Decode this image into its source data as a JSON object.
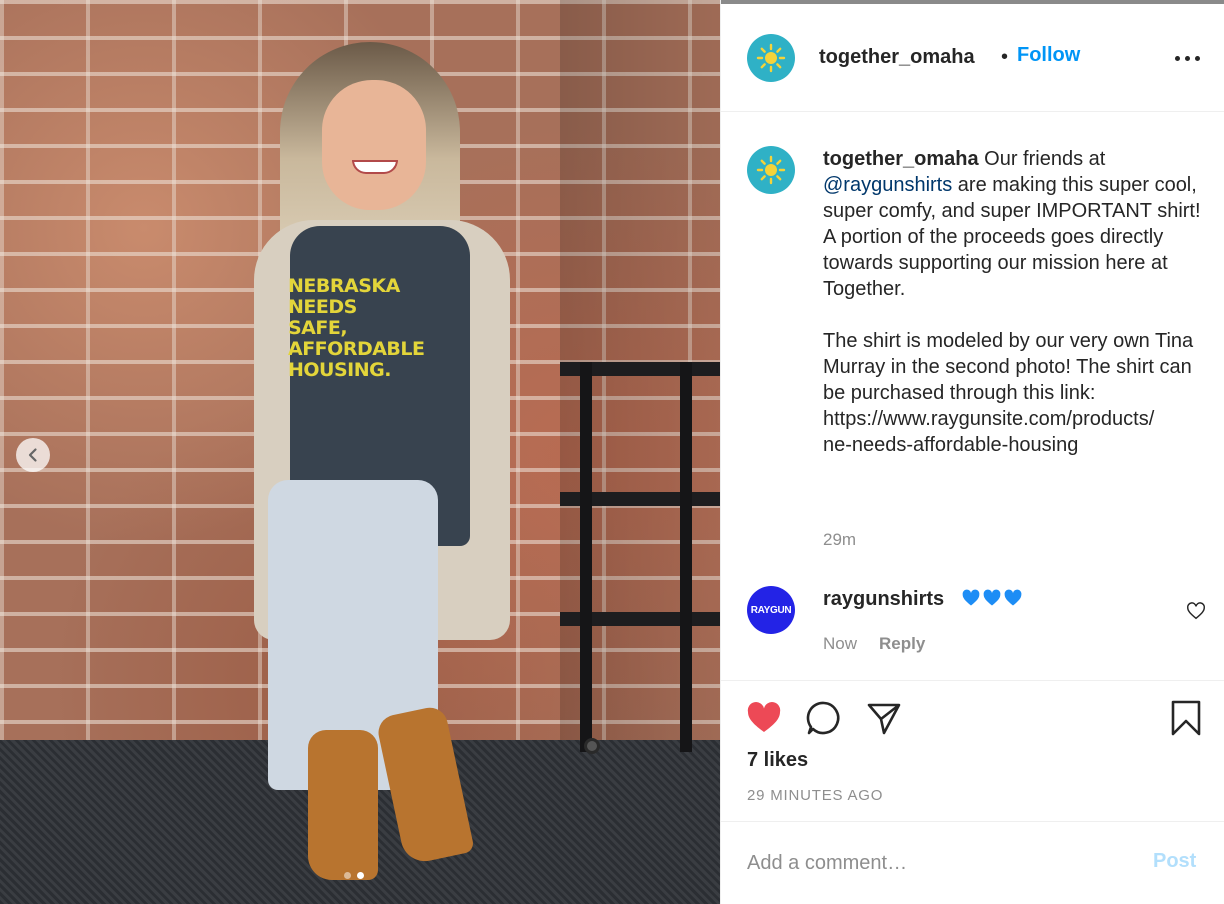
{
  "post": {
    "author": "together_omaha",
    "separator": "•",
    "follow_label": "Follow",
    "more_icon": "more-horizontal-icon",
    "shirt_print": [
      "NEBRASKA",
      "NEEDS",
      "SAFE,",
      "AFFORDABLE",
      "HOUSING."
    ],
    "carousel": {
      "total": 2,
      "current": 2
    }
  },
  "caption": {
    "author": "together_omaha",
    "text_before_mention": " Our friends at\n",
    "mention": "@raygunshirts",
    "text_after_mention": " are making this super cool, super comfy, and super IMPORTANT shirt! A portion of the proceeds goes directly towards supporting our mission here at Together.\n\nThe shirt is modeled by our very own Tina Murray in the second photo! The shirt can be purchased through this link:\nhttps://www.raygunsite.com/products/\nne-needs-affordable-housing",
    "time": "29m"
  },
  "comment": {
    "author": "raygunshirts",
    "avatar_text": "RAYGUN",
    "text_emoji": "💙💙💙",
    "time": "Now",
    "reply_label": "Reply"
  },
  "actions": {
    "likes": "7 likes",
    "posted_ago": "29 MINUTES AGO",
    "liked": true
  },
  "add_comment": {
    "placeholder": "Add a comment…",
    "post_label": "Post"
  },
  "colors": {
    "accent": "#0095f6",
    "like_red": "#ed4956",
    "avatar_together": "#2fb1c6",
    "avatar_raygun": "#2323e6",
    "post_disabled": "#b2dffc"
  }
}
